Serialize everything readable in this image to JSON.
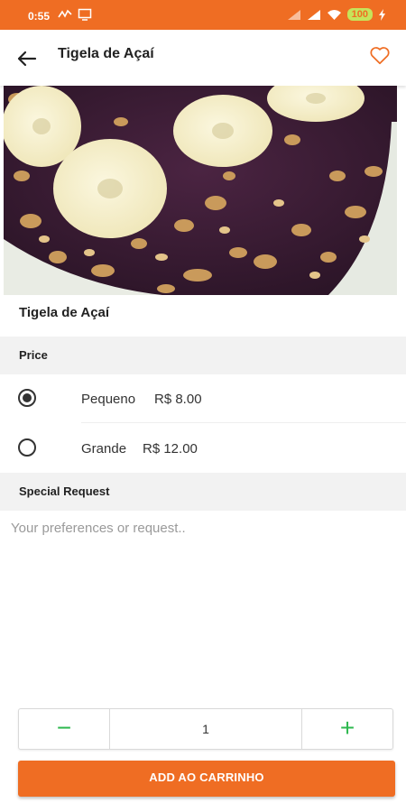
{
  "status_bar": {
    "time": "0:55",
    "battery": "100",
    "icons": [
      "activity-icon",
      "cast-icon",
      "signal-icon",
      "signal-icon",
      "wifi-icon",
      "battery-icon",
      "charging-icon"
    ]
  },
  "app_bar": {
    "title": "Tigela de Açaí",
    "back_icon": "arrow-left-icon",
    "favorite_icon": "heart-outline-icon"
  },
  "product": {
    "title": "Tigela de Açaí",
    "image_subject": "acai bowl with banana slices and granola"
  },
  "price_section": {
    "header": "Price",
    "options": [
      {
        "label": "Pequeno",
        "price": "R$ 8.00",
        "selected": true
      },
      {
        "label": "Grande",
        "price": "R$ 12.00",
        "selected": false
      }
    ]
  },
  "special_request": {
    "header": "Special Request",
    "placeholder": "Your preferences or request..",
    "value": ""
  },
  "quantity": {
    "minus": "−",
    "value": "1",
    "plus": "+"
  },
  "cart_button": {
    "label": "ADD AO CARRINHO"
  },
  "colors": {
    "brand_orange": "#ef6d23",
    "stepper_green": "#2eb84f",
    "section_bg": "#f2f2f2"
  }
}
